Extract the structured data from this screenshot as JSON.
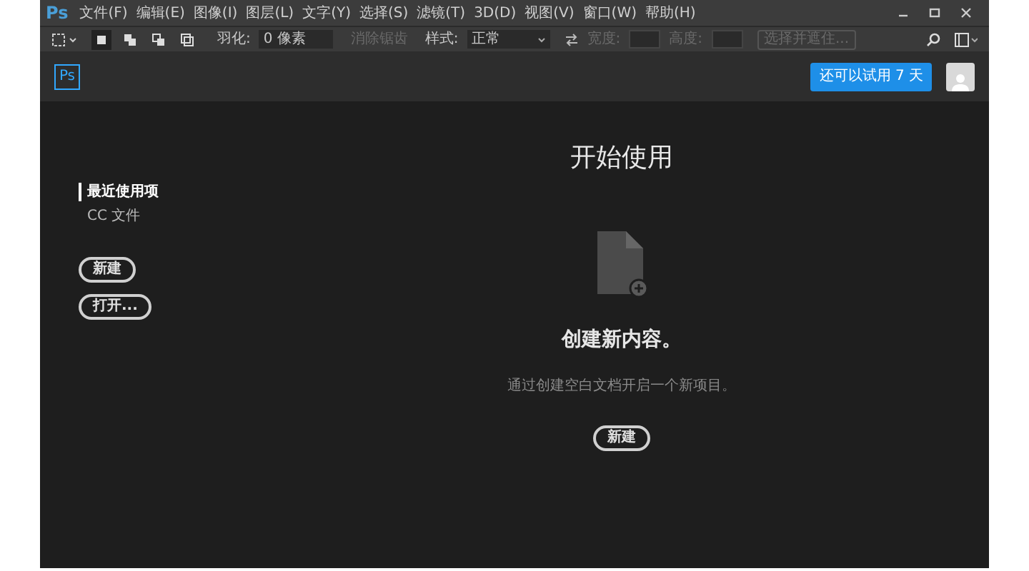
{
  "window": {
    "app": "Ps"
  },
  "menu": [
    "文件(F)",
    "编辑(E)",
    "图像(I)",
    "图层(L)",
    "文字(Y)",
    "选择(S)",
    "滤镜(T)",
    "3D(D)",
    "视图(V)",
    "窗口(W)",
    "帮助(H)"
  ],
  "options": {
    "modes": [
      {
        "selected": true
      },
      {
        "selected": false
      },
      {
        "selected": false
      },
      {
        "selected": false
      }
    ],
    "feather_label": "羽化:",
    "feather_value": "0 像素",
    "antialias": {
      "label": "消除锯齿",
      "disabled": true
    },
    "style_label": "样式:",
    "style_value": "正常",
    "width_label": "宽度:",
    "height_label": "高度:",
    "dims_disabled": true,
    "mask_button": {
      "label": "选择并遮住...",
      "disabled": true
    }
  },
  "header": {
    "logo": "Ps",
    "trial_button": "还可以试用 7 天"
  },
  "sidebar": {
    "items": [
      {
        "label": "最近使用项",
        "selected": true
      },
      {
        "label": "CC 文件",
        "selected": false
      }
    ],
    "buttons": [
      "新建",
      "打开..."
    ]
  },
  "main": {
    "title": "开始使用",
    "heading": "创建新内容。",
    "description": "通过创建空白文档开启一个新项目。",
    "button": "新建"
  }
}
